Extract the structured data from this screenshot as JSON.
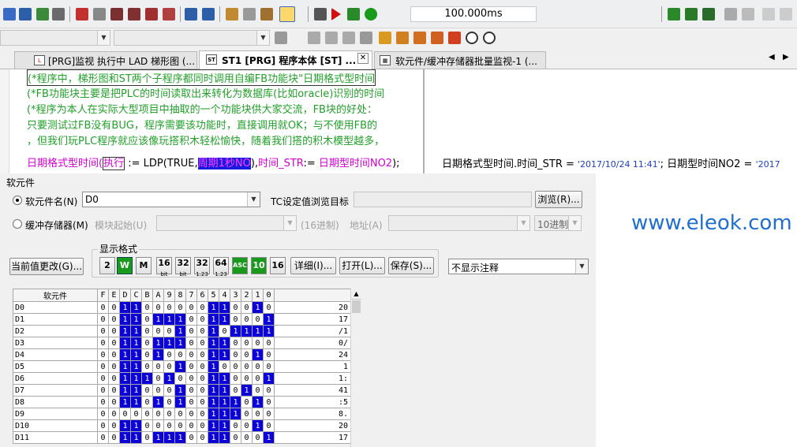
{
  "toolbar": {
    "scan_time": "100.000ms"
  },
  "tabs": [
    {
      "label": "[PRG]监视 执行中 LAD 梯形图 (...",
      "icon": "ladder-icon"
    },
    {
      "label": "ST1 [PRG] 程序本体 [ST] ...",
      "icon": "st-icon"
    },
    {
      "label": "软元件/缓冲存储器批量监视-1 (...",
      "icon": "monitor-icon"
    }
  ],
  "editor": {
    "comments": [
      "(*程序中，梯形图和ST两个子程序都同时调用自编FB功能块\"日期格式型时间",
      "(*FB功能块主要是把PLC的时间读取出来转化为数据库(比如oracle)识别的时间",
      "(*程序为本人在实际大型项目中抽取的一个功能块供大家交流，FB块的好处：",
      "只要测试过FB没有BUG，程序需要该功能时，直接调用就OK；与不使用FB的",
      "，但我们玩PLC程序就应该像玩搭积木轻松愉快，随着我们搭的积木模型越多，"
    ],
    "stmt": {
      "inst": "日期格式型时间",
      "paren_open": "(",
      "exec": "执行",
      "assign1": " := LDP(TRUE,",
      "period": "周期1秒NO",
      "close1": "),",
      "field": "时间_STR",
      "assign2": ":= ",
      "var": "日期型时间NO2",
      "end": ");"
    },
    "monitor_line": {
      "p1": "日期格式型时间.时间_STR = ",
      "v1": "'2017/10/24 11:41'",
      "p2": "; 日期型时间NO2 = ",
      "v2": "'2017"
    }
  },
  "watermark": "www.eleok.com",
  "device_panel": {
    "group_title": "软元件",
    "radio_device": "软元件名(N)",
    "device_value": "D0",
    "tc_label": "TC设定值浏览目标",
    "browse_btn": "浏览(R)...",
    "radio_buffer": "缓冲存储器(M)",
    "module_start": "模块起始(U)",
    "hex16": "(16进制)",
    "address": "地址(A)",
    "radix_value": "10进制",
    "current_change_btn": "当前值更改(G)...",
    "format_title": "显示格式",
    "fmt_buttons": [
      "2",
      "W",
      "M",
      "16",
      "32",
      "32",
      "64",
      "ASC",
      "10",
      "16"
    ],
    "fmt_sub": [
      "",
      "",
      "",
      "bit",
      "bit",
      "1.23",
      "1.23",
      "",
      "",
      ""
    ],
    "detail_btn": "详细(I)...",
    "open_btn": "打开(L)...",
    "save_btn": "保存(S)...",
    "comment_select": "不显示注释"
  },
  "grid": {
    "header_name": "软元件",
    "bits": [
      "F",
      "E",
      "D",
      "C",
      "B",
      "A",
      "9",
      "8",
      "7",
      "6",
      "5",
      "4",
      "3",
      "2",
      "1",
      "0"
    ],
    "rows": [
      {
        "name": "D0",
        "bits": "0011000000110010",
        "value": "20"
      },
      {
        "name": "D1",
        "bits": "0011011100110001",
        "value": "17"
      },
      {
        "name": "D2",
        "bits": "0011000100101111",
        "value": "/1"
      },
      {
        "name": "D3",
        "bits": "0011011100110000",
        "value": "0/"
      },
      {
        "name": "D4",
        "bits": "0011010000110010",
        "value": "24"
      },
      {
        "name": "D5",
        "bits": "0011000100100000",
        "value": "1"
      },
      {
        "name": "D6",
        "bits": "0011101000110001",
        "value": "1:"
      },
      {
        "name": "D7",
        "bits": "0011000100110100",
        "value": "41"
      },
      {
        "name": "D8",
        "bits": "0011010100111010",
        "value": ":5"
      },
      {
        "name": "D9",
        "bits": "0000000000111000",
        "value": "8."
      },
      {
        "name": "D10",
        "bits": "0011000000110010",
        "value": "20"
      },
      {
        "name": "D11",
        "bits": "0011011100110001",
        "value": "17"
      }
    ]
  },
  "colors": {
    "bit_on": "#0b00d8",
    "comment": "#22a02a",
    "keyword": "#d000d0",
    "watermark": "#1f6fd0"
  }
}
